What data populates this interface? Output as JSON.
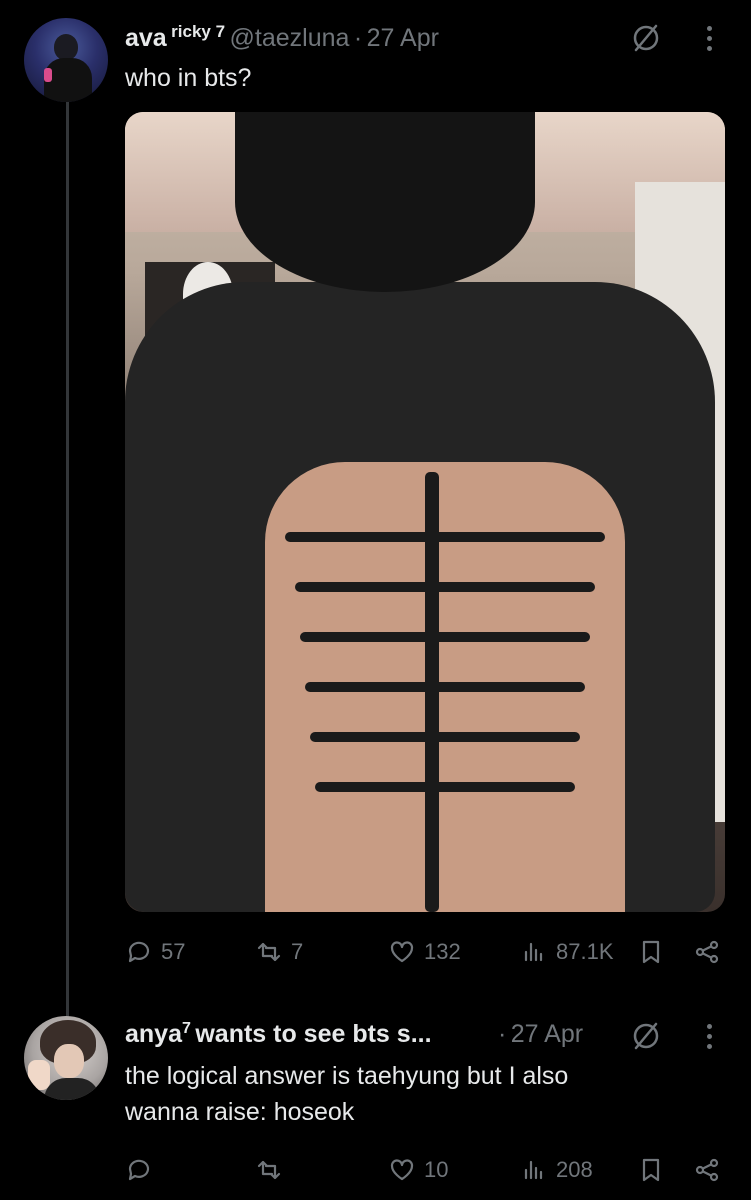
{
  "tweet": {
    "display_name": "ava",
    "name_suffix": "ricky 7",
    "handle": "@taezluna",
    "separator": "·",
    "date": "27 Apr",
    "text": "who in bts?",
    "stats": {
      "replies": "57",
      "reposts": "7",
      "likes": "132",
      "views": "87.1K"
    }
  },
  "reply": {
    "display_name": "anya",
    "sup": "7",
    "name_rest": "wants to see bts s...",
    "separator": "·",
    "date": "27 Apr",
    "text_line1": "the logical answer is taehyung but I also",
    "text_line2": "wanna raise: hoseok",
    "stats": {
      "replies": "",
      "reposts": "",
      "likes": "10",
      "views": "208"
    }
  },
  "colors": {
    "background": "#000000",
    "text": "#e7e9ea",
    "muted": "#71767b",
    "thread_line": "#333639"
  },
  "icons": [
    "grok-icon",
    "more-icon",
    "reply-icon",
    "repost-icon",
    "like-icon",
    "views-icon",
    "bookmark-icon",
    "share-icon"
  ]
}
